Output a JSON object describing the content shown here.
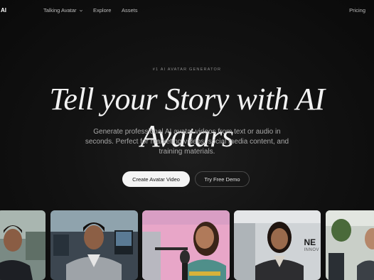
{
  "nav": {
    "logo": "AI",
    "items": [
      {
        "label": "Talking Avatar",
        "has_dropdown": true
      },
      {
        "label": "Explore"
      },
      {
        "label": "Assets"
      }
    ],
    "pricing": "Pricing"
  },
  "hero": {
    "eyebrow": "#1 AI AVATAR GENERATOR",
    "title": "Tell your Story with AI Avatars",
    "subtitle": "Generate professional AI avatar videos from text or audio in seconds. Perfect for marketing videos, social media content, and training materials.",
    "primary_button": "Create Avatar Video",
    "secondary_button": "Try Free Demo"
  },
  "cards": [
    {
      "name": "avatar-man-office"
    },
    {
      "name": "avatar-man-hoodie"
    },
    {
      "name": "avatar-woman-podcast"
    },
    {
      "name": "avatar-woman-business",
      "badge": "NE",
      "badge_sub": "INNOV"
    },
    {
      "name": "avatar-man-partial"
    }
  ]
}
